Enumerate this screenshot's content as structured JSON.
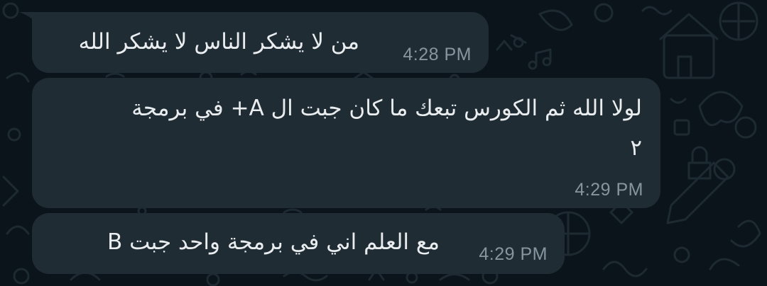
{
  "chat": {
    "messages": [
      {
        "text": "من لا يشكر الناس لا يشكر الله",
        "time": "4:28 PM"
      },
      {
        "line1": "لولا الله ثم الكورس تبعك ما كان جبت ال A+ في برمجة",
        "line2": "٢",
        "time": "4:29 PM"
      },
      {
        "text": "مع العلم اني في برمجة واحد جبت B",
        "time": "4:29 PM"
      }
    ]
  },
  "colors": {
    "background": "#0b141a",
    "bubble_incoming": "#202c33",
    "message_text": "#e9edef",
    "timestamp_text": "#8696a0",
    "wallpaper_doodle": "#1c262c"
  }
}
